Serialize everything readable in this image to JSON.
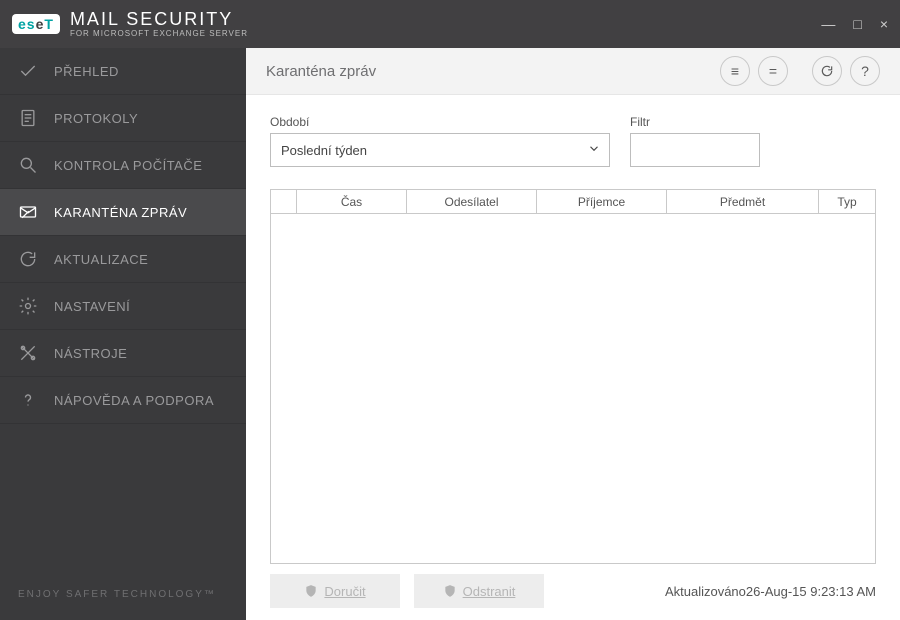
{
  "brand": {
    "badge_left": "es",
    "badge_mid": "e",
    "badge_right": "T",
    "title": "MAIL SECURITY",
    "subtitle": "FOR MICROSOFT EXCHANGE SERVER",
    "footer": "ENJOY SAFER TECHNOLOGY™"
  },
  "window_controls": {
    "minimize": "—",
    "maximize": "□",
    "close": "×"
  },
  "sidebar": {
    "items": [
      {
        "label": "PŘEHLED"
      },
      {
        "label": "PROTOKOLY"
      },
      {
        "label": "KONTROLA POČÍTAČE"
      },
      {
        "label": "KARANTÉNA ZPRÁV"
      },
      {
        "label": "AKTUALIZACE"
      },
      {
        "label": "NASTAVENÍ"
      },
      {
        "label": "NÁSTROJE"
      },
      {
        "label": "NÁPOVĚDA A PODPORA"
      }
    ],
    "selected_index": 3
  },
  "page": {
    "title": "Karanténa zpráv"
  },
  "header_actions": {
    "menu": "≡",
    "equal": "=",
    "refresh": "↻",
    "help": "?"
  },
  "filters": {
    "period_label": "Období",
    "period_value": "Poslední týden",
    "filter_label": "Filtr",
    "filter_value": ""
  },
  "table": {
    "columns": {
      "time": "Čas",
      "sender": "Odesílatel",
      "recipient": "Příjemce",
      "subject": "Předmět",
      "type": "Typ"
    },
    "rows": []
  },
  "actions": {
    "deliver": "Doručit",
    "delete": "Odstranit"
  },
  "status": {
    "updated_label": "Aktualizováno",
    "updated_value": "26-Aug-15 9:23:13 AM"
  }
}
